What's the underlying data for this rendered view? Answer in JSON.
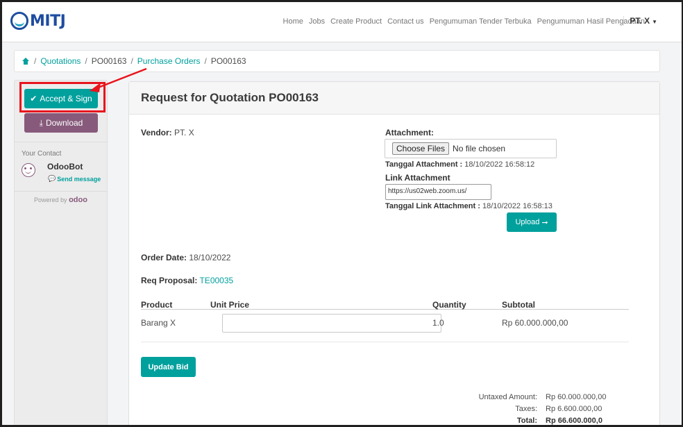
{
  "navbar": {
    "logo_text": "MITJ",
    "links": [
      "Home",
      "Jobs",
      "Create Product",
      "Contact us",
      "Pengumuman Tender Terbuka",
      "Pengumuman Hasil Pengadaan"
    ],
    "user": "PT. X"
  },
  "breadcrumb": {
    "items": [
      "Quotations",
      "PO00163",
      "Purchase Orders",
      "PO00163"
    ]
  },
  "sidebar": {
    "accept_sign": "Accept & Sign",
    "download": "Download",
    "your_contact": "Your Contact",
    "contact_name": "OdooBot",
    "send_message": "Send message",
    "powered_by": "Powered by",
    "powered_brand": "odoo"
  },
  "card": {
    "title": "Request for Quotation PO00163",
    "vendor_label": "Vendor:",
    "vendor_value": "PT. X",
    "attachment_label": "Attachment:",
    "file_button": "Choose Files",
    "file_status": "No file chosen",
    "tanggal_attachment_label": "Tanggal Attachment :",
    "tanggal_attachment_value": "18/10/2022 16:58:12",
    "link_attachment_label": "Link Attachment",
    "link_attachment_value": "https://us02web.zoom.us/",
    "tanggal_link_label": "Tanggal Link Attachment :",
    "tanggal_link_value": "18/10/2022 16:58:13",
    "upload_button": "Upload",
    "order_date_label": "Order Date:",
    "order_date_value": "18/10/2022",
    "req_proposal_label": "Req Proposal:",
    "req_proposal_value": "TE00035",
    "table": {
      "headers": [
        "Product",
        "Unit Price",
        "Quantity",
        "Subtotal"
      ],
      "rows": [
        {
          "product": "Barang X",
          "unit_price": "",
          "quantity": "1.0",
          "subtotal": "Rp 60.000.000,00"
        }
      ]
    },
    "update_bid": "Update Bid",
    "totals": {
      "untaxed_label": "Untaxed Amount:",
      "untaxed_value": "Rp 60.000.000,00",
      "taxes_label": "Taxes:",
      "taxes_value": "Rp 6.600.000,00",
      "total_label": "Total:",
      "total_value": "Rp 66.600.000,0"
    }
  },
  "colors": {
    "primary": "#00a09d",
    "secondary": "#875a7b",
    "highlight": "#e8141c",
    "brand": "#1e4ca0"
  }
}
